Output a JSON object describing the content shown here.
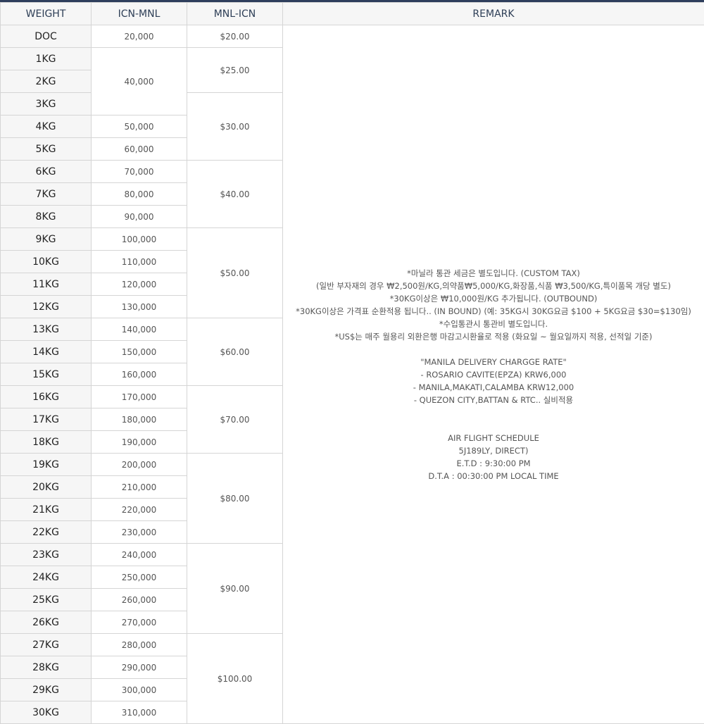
{
  "headers": {
    "weight": "WEIGHT",
    "icn_mnl": "ICN-MNL",
    "mnl_icn": "MNL-ICN",
    "remark": "REMARK"
  },
  "weights": [
    "DOC",
    "1KG",
    "2KG",
    "3KG",
    "4KG",
    "5KG",
    "6KG",
    "7KG",
    "8KG",
    "9KG",
    "10KG",
    "11KG",
    "12KG",
    "13KG",
    "14KG",
    "15KG",
    "16KG",
    "17KG",
    "18KG",
    "19KG",
    "20KG",
    "21KG",
    "22KG",
    "23KG",
    "24KG",
    "25KG",
    "26KG",
    "27KG",
    "28KG",
    "29KG",
    "30KG"
  ],
  "icn_mnl": [
    "20,000",
    "40,000",
    "50,000",
    "60,000",
    "70,000",
    "80,000",
    "90,000",
    "100,000",
    "110,000",
    "120,000",
    "130,000",
    "140,000",
    "150,000",
    "160,000",
    "170,000",
    "180,000",
    "190,000",
    "200,000",
    "210,000",
    "220,000",
    "230,000",
    "240,000",
    "250,000",
    "260,000",
    "270,000",
    "280,000",
    "290,000",
    "300,000",
    "310,000"
  ],
  "mnl_icn": [
    "$20.00",
    "$25.00",
    "$30.00",
    "$40.00",
    "$50.00",
    "$60.00",
    "$70.00",
    "$80.00",
    "$90.00",
    "$100.00"
  ],
  "remark": {
    "customs": [
      "*마닐라 통관 세금은 별도입니다. (CUSTOM TAX)",
      "(일반 부자재의 경우 ₩2,500원/KG,의약품₩5,000/KG,화장품,식품 ₩3,500/KG,특이품목 개당 별도)",
      "*30KG이상은 ₩10,000원/KG 추가됩니다. (OUTBOUND)",
      "*30KG이상은 가격표 순환적용 됩니다.. (IN BOUND) (예: 35KG시 30KG요금 $100 + 5KG요금 $30=$130임)",
      "*수입통관시 통관비 별도입니다.",
      "*US$는 매주 월용리 외환은행 마감고시환율로 적용 (화요일 ~ 월요일까지 적용, 선적일 기준)"
    ],
    "delivery": [
      "\"MANILA DELIVERY CHARGGE RATE\"",
      "- ROSARIO CAVITE(EPZA) KRW6,000",
      "- MANILA,MAKATI,CALAMBA KRW12,000",
      "- QUEZON CITY,BATTAN & RTC.. 실비적용"
    ],
    "schedule": [
      "AIR FLIGHT SCHEDULE",
      "5J189LY, DIRECT)",
      "E.T.D : 9:30:00 PM",
      "D.T.A : 00:30:00 PM LOCAL TIME"
    ]
  }
}
